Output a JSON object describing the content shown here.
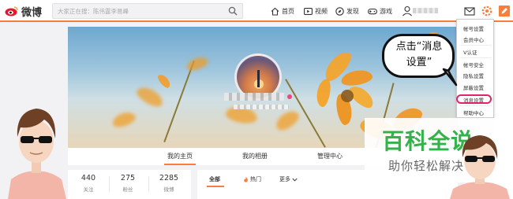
{
  "top_nav": {
    "logo_text": "微博",
    "search_placeholder": "大家正在搜：陈伟霆李易峰",
    "items": [
      {
        "label": "首页",
        "icon": "home-icon"
      },
      {
        "label": "视频",
        "icon": "video-icon"
      },
      {
        "label": "发现",
        "icon": "discover-icon"
      },
      {
        "label": "游戏",
        "icon": "game-icon"
      }
    ],
    "right_icons": [
      "mail-icon",
      "gear-icon",
      "compose-icon"
    ],
    "accent": "#fa7d3c"
  },
  "profile_tabs": {
    "items": [
      "我的主页",
      "我的相册",
      "管理中心"
    ],
    "active_index": 0
  },
  "stats": [
    {
      "num": "440",
      "label": "关注"
    },
    {
      "num": "275",
      "label": "粉丝"
    },
    {
      "num": "2285",
      "label": "微博"
    }
  ],
  "feed_filter": {
    "items": [
      "全部",
      "热门",
      "更多"
    ],
    "selected_index": 0
  },
  "settings_menu": {
    "items": [
      "帐号设置",
      "会员中心",
      "V认证",
      "帐号安全",
      "隐私设置",
      "屏蔽设置",
      "消息设置",
      "帮助中心"
    ],
    "highlighted": "消息设置",
    "highlight_color": "#e2226a"
  },
  "callout": {
    "line1": "点击“消息",
    "line2": "设置”"
  },
  "watermark": {
    "title": "百科全说",
    "subtitle": "助你轻松解决",
    "color": "#33b24a"
  }
}
